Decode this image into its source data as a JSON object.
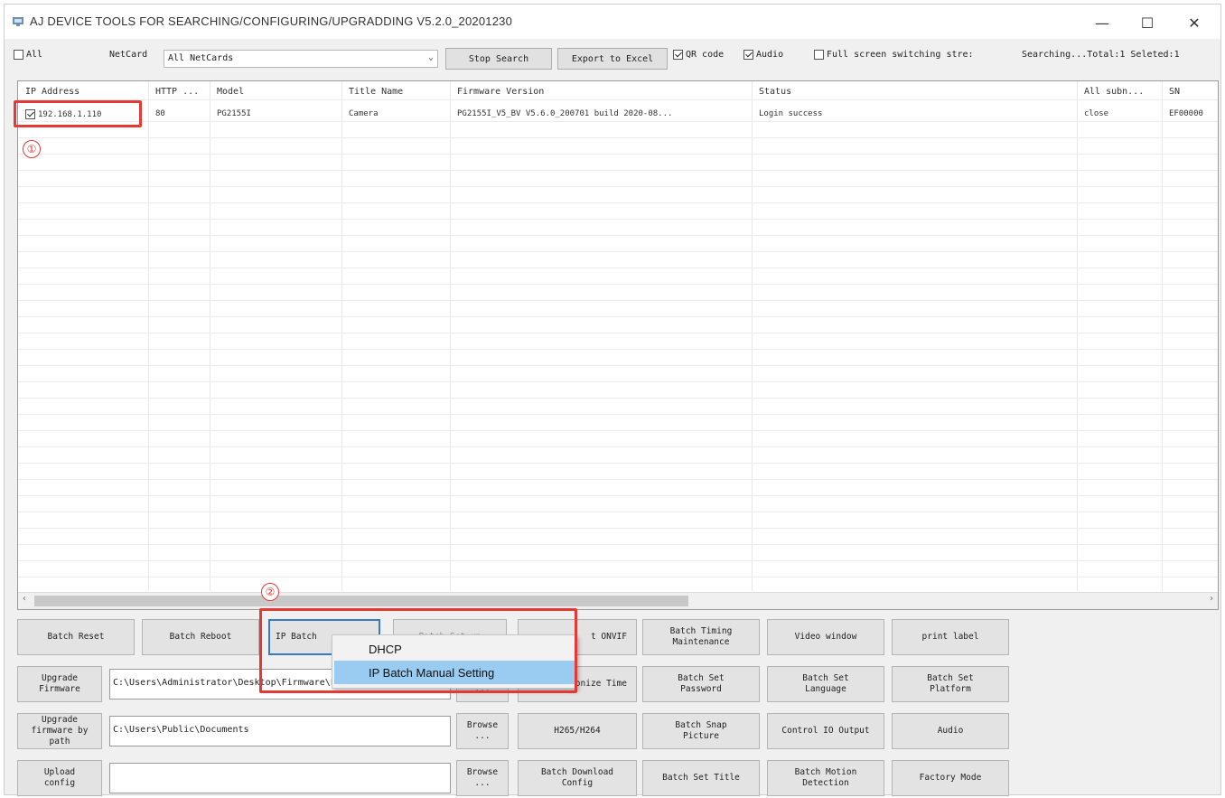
{
  "window": {
    "title": "AJ DEVICE TOOLS FOR SEARCHING/CONFIGURING/UPGRADDING V5.2.0_20201230",
    "minimize": "—",
    "maximize": "☐",
    "close": "✕"
  },
  "toolbar": {
    "all_label": "All",
    "netcard_label": "NetCard",
    "netcard_value": "All NetCards",
    "stop_search": "Stop Search",
    "export_excel": "Export to Excel",
    "qr_code": "QR code",
    "audio": "Audio",
    "full_screen": "Full screen switching stre:",
    "status_text": "Searching...Total:1 Seleted:1"
  },
  "grid": {
    "columns": [
      "IP Address",
      "HTTP ...",
      "Model",
      "Title Name",
      "Firmware Version",
      "Status",
      "All subn...",
      "SN"
    ],
    "rows": [
      {
        "ip": "192.168.1.110",
        "http": "80",
        "model": "PG2155I",
        "title": "Camera",
        "firmware": "PG2155I_V5_BV V5.6.0_200701 build 2020-08...",
        "status": "Login success",
        "subnet": "close",
        "sn": "EF00000"
      }
    ]
  },
  "annotations": {
    "marker1": "①",
    "marker2": "②"
  },
  "buttons": {
    "batch_reset": "Batch Reset",
    "batch_reboot": "Batch Reboot",
    "ip_batch": "IP Batch",
    "batch_setup_hidden": "Batch Set up",
    "onvif": "t ONVIF",
    "batch_timing": "Batch Timing\nMaintenance",
    "video_window": "Video window",
    "print_label": "print label",
    "upgrade_firmware": "Upgrade\nFirmware",
    "firmware_path": "C:\\Users\\Administrator\\Desktop\\Firmware\\PG2155I\\PG...",
    "sync_time": "ronize Time",
    "batch_set_password": "Batch Set\nPassword",
    "batch_set_language": "Batch Set\nLanguage",
    "batch_set_platform": "Batch Set\nPlatform",
    "upgrade_by_path": "Upgrade\nfirmware by\npath",
    "public_path": "C:\\Users\\Public\\Documents",
    "browse": "Browse\n...",
    "h265": "H265/H264",
    "batch_snap": "Batch Snap\nPicture",
    "control_io": "Control IO Output",
    "audio_btn": "Audio",
    "upload_config": "Upload\nconfig",
    "upload_path": "",
    "batch_download": "Batch Download\nConfig",
    "batch_set_title": "Batch Set Title",
    "batch_motion": "Batch Motion\nDetection",
    "factory_mode": "Factory Mode"
  },
  "context_menu": {
    "items": [
      "DHCP",
      "IP Batch Manual Setting"
    ]
  },
  "colors": {
    "annotation": "#e53935",
    "menu_highlight": "#99ccf0"
  }
}
